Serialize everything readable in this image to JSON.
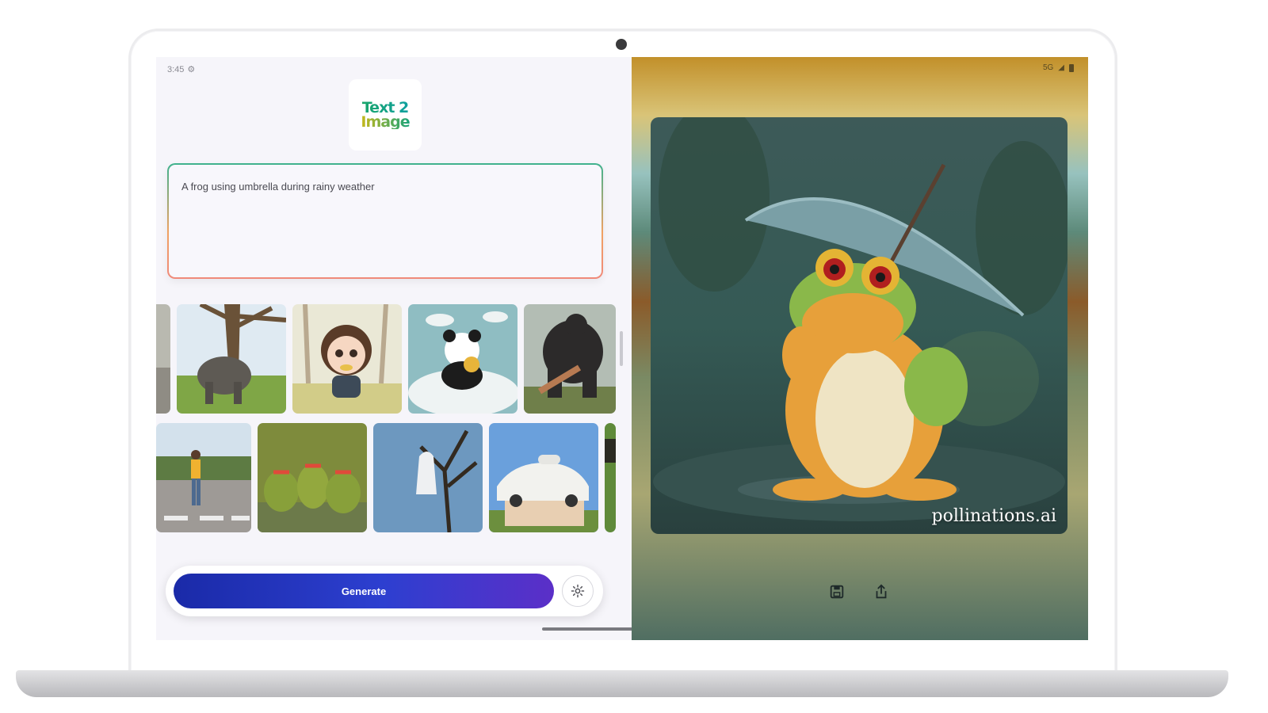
{
  "status": {
    "time": "3:45",
    "network": "5G"
  },
  "app": {
    "logo_line1": "Text 2",
    "logo_line2": "Image"
  },
  "prompt": {
    "value": "A frog using umbrella during rainy weather"
  },
  "gallery": {
    "row1": [
      "elephant-under-tree",
      "chibi-girl-eating",
      "panda-on-cloud",
      "gorilla-fighting"
    ],
    "row2": [
      "boy-crossing-street",
      "crocodiles-in-water",
      "ghost-on-tree",
      "car-on-roof"
    ]
  },
  "actions": {
    "generate_label": "Generate",
    "settings_icon": "gear-icon",
    "save_icon": "save-icon",
    "share_icon": "share-icon"
  },
  "result": {
    "subject": "frog-with-umbrella",
    "watermark": "pollinations.ai"
  },
  "colors": {
    "generate_start": "#1a2aa8",
    "generate_end": "#5b2fc8",
    "prompt_border_top": "#3fb28e",
    "prompt_border_bottom": "#f08a7a"
  }
}
